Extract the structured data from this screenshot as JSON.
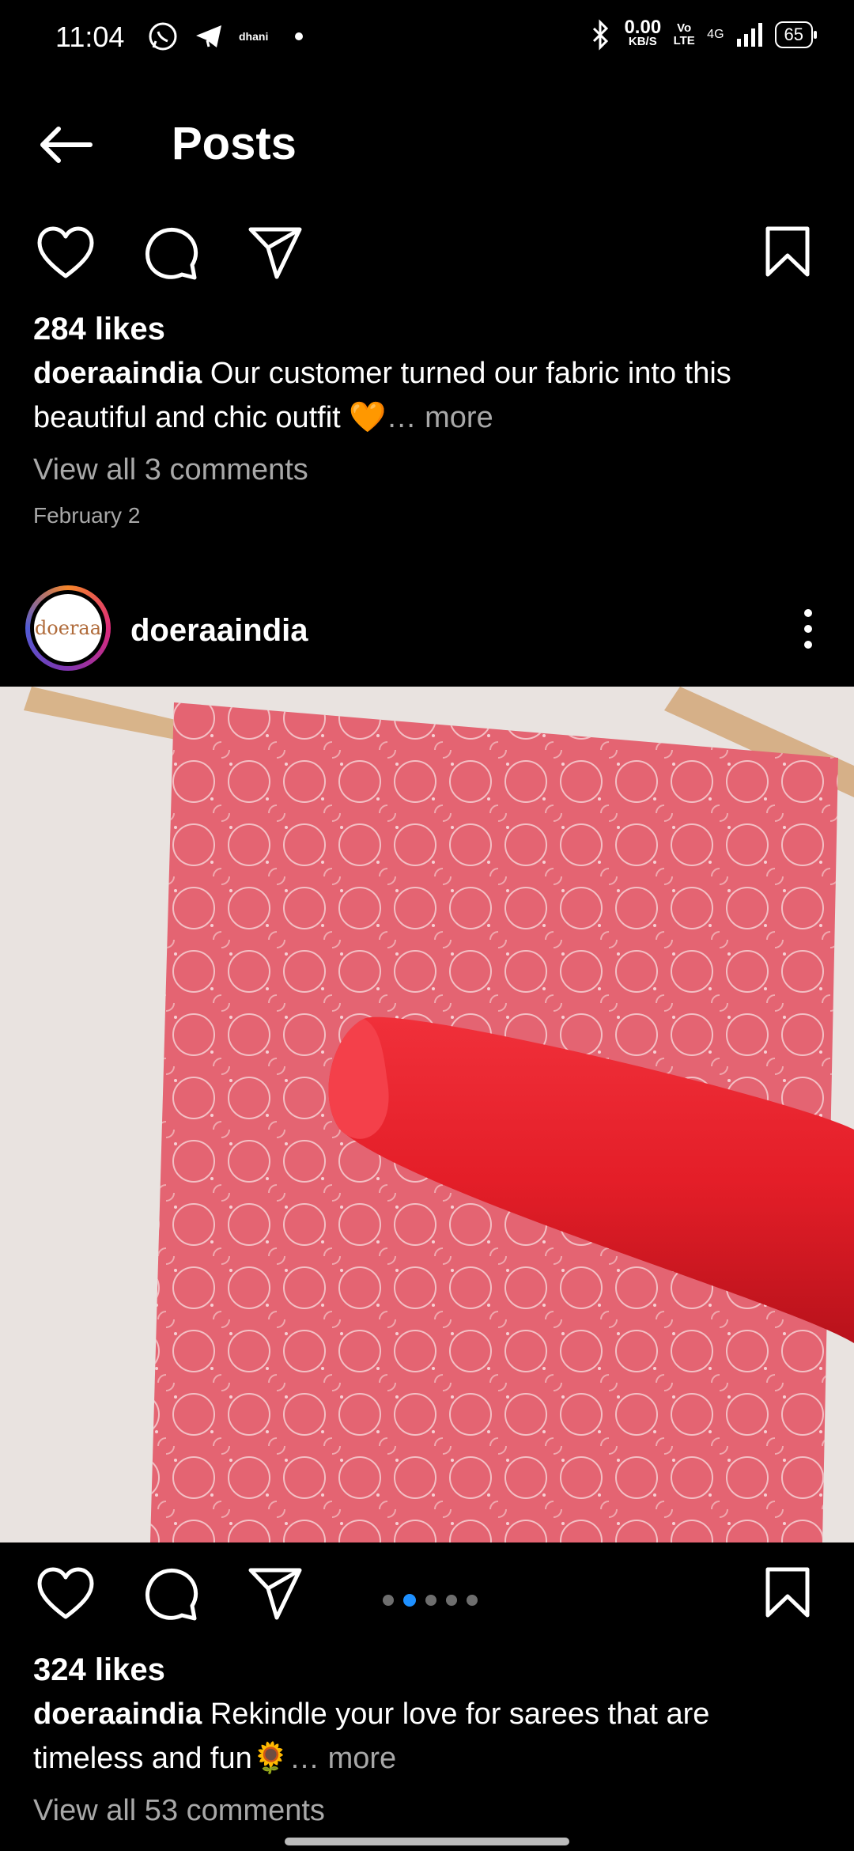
{
  "status_bar": {
    "time": "11:04",
    "app_label": "dhani",
    "net_speed": "0.00",
    "net_unit": "KB/S",
    "volte": "Vo LTE",
    "network": "4G",
    "battery": "65"
  },
  "header": {
    "title": "Posts"
  },
  "post1": {
    "likes": "284 likes",
    "username": "doeraaindia",
    "caption": "Our customer turned our fabric into this beautiful and chic outfit 🧡",
    "more": "… more",
    "comments": "View all 3 comments",
    "date": "February 2"
  },
  "post2": {
    "username": "doeraaindia",
    "avatar_text": "doeraa",
    "carousel_count": 5,
    "carousel_active": 2,
    "likes": "324 likes",
    "caption": "Rekindle your love for sarees that are timeless and fun🌻",
    "more": "… more",
    "comments": "View all 53 comments"
  },
  "colors": {
    "accent": "#1e90ff",
    "fabric_pink": "#e25766",
    "fabric_red": "#e8202b"
  }
}
